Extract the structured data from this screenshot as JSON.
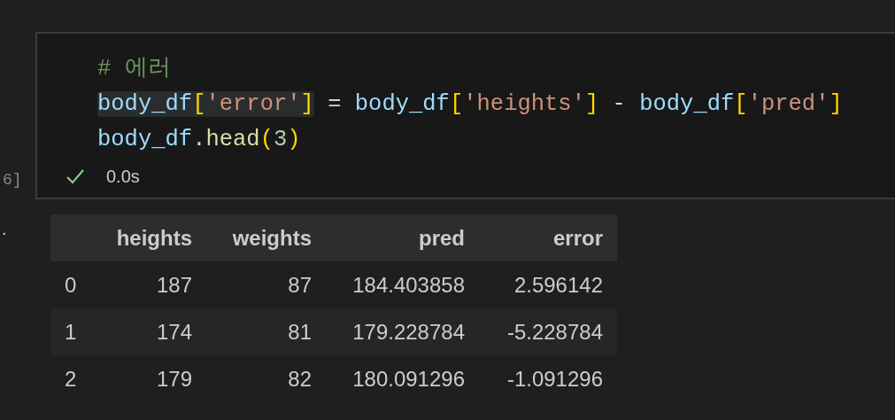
{
  "cell": {
    "execution_count": "6]",
    "code_lines": [
      {
        "segments": [
          {
            "highlighted": false,
            "tokens": [
              {
                "text": "# 에러",
                "kind": "comment"
              }
            ]
          }
        ]
      },
      {
        "segments": [
          {
            "highlighted": true,
            "tokens": [
              {
                "text": "body_df",
                "kind": "variable"
              },
              {
                "text": "[",
                "kind": "bracket"
              },
              {
                "text": "'error'",
                "kind": "string"
              },
              {
                "text": "]",
                "kind": "bracket"
              }
            ]
          },
          {
            "highlighted": false,
            "tokens": [
              {
                "text": " = ",
                "kind": "operator"
              },
              {
                "text": "body_df",
                "kind": "variable"
              },
              {
                "text": "[",
                "kind": "bracket"
              },
              {
                "text": "'heights'",
                "kind": "string"
              },
              {
                "text": "]",
                "kind": "bracket"
              },
              {
                "text": " - ",
                "kind": "operator"
              },
              {
                "text": "body_df",
                "kind": "variable"
              },
              {
                "text": "[",
                "kind": "bracket"
              },
              {
                "text": "'pred'",
                "kind": "string"
              },
              {
                "text": "]",
                "kind": "bracket"
              }
            ]
          }
        ]
      },
      {
        "segments": [
          {
            "highlighted": false,
            "tokens": [
              {
                "text": "body_df",
                "kind": "variable"
              },
              {
                "text": ".",
                "kind": "operator"
              },
              {
                "text": "head",
                "kind": "function"
              },
              {
                "text": "(",
                "kind": "bracket"
              },
              {
                "text": "3",
                "kind": "number"
              },
              {
                "text": ")",
                "kind": "bracket"
              }
            ]
          }
        ]
      }
    ],
    "status": {
      "succeeded": true,
      "duration": "0.0s"
    }
  },
  "output": {
    "marker": ".",
    "table": {
      "columns": [
        "",
        "heights",
        "weights",
        "pred",
        "error"
      ],
      "rows": [
        [
          "0",
          "187",
          "87",
          "184.403858",
          "2.596142"
        ],
        [
          "1",
          "174",
          "81",
          "179.228784",
          "-5.228784"
        ],
        [
          "2",
          "179",
          "82",
          "180.091296",
          "-1.091296"
        ]
      ]
    }
  }
}
